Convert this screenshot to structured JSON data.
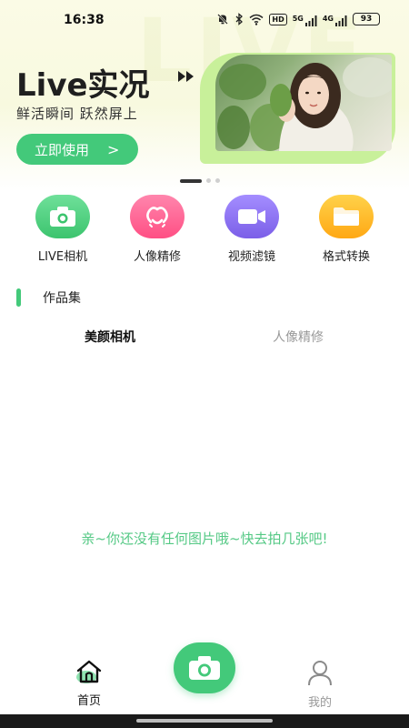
{
  "status_bar": {
    "time": "16:38",
    "hd_tag": "HD",
    "net_5g": "5G",
    "net_4g": "4G",
    "battery": "93"
  },
  "banner": {
    "watermark": "LIVE",
    "title": "Live实况",
    "subtitle": "鲜活瞬间 跃然屏上",
    "button_label": "立即使用",
    "button_chevron": ">",
    "carousel_total": 3,
    "carousel_active": 1
  },
  "features": [
    {
      "label": "LIVE相机",
      "icon": "camera-icon",
      "color": "#4cd07c"
    },
    {
      "label": "人像精修",
      "icon": "portrait-retouch-icon",
      "color": "#ff5d8e"
    },
    {
      "label": "视频滤镜",
      "icon": "video-camera-icon",
      "color": "#8a6ff0"
    },
    {
      "label": "格式转换",
      "icon": "folder-icon",
      "color": "#ffb21f"
    }
  ],
  "section": {
    "title": "作品集"
  },
  "tabs": [
    {
      "label": "美颜相机",
      "active": true
    },
    {
      "label": "人像精修",
      "active": false
    }
  ],
  "empty_message": "亲~你还没有任何图片哦~快去拍几张吧!",
  "bottom_nav": {
    "home_label": "首页",
    "mine_label": "我的"
  },
  "colors": {
    "accent": "#43c97a",
    "empty_text": "#55c985"
  }
}
